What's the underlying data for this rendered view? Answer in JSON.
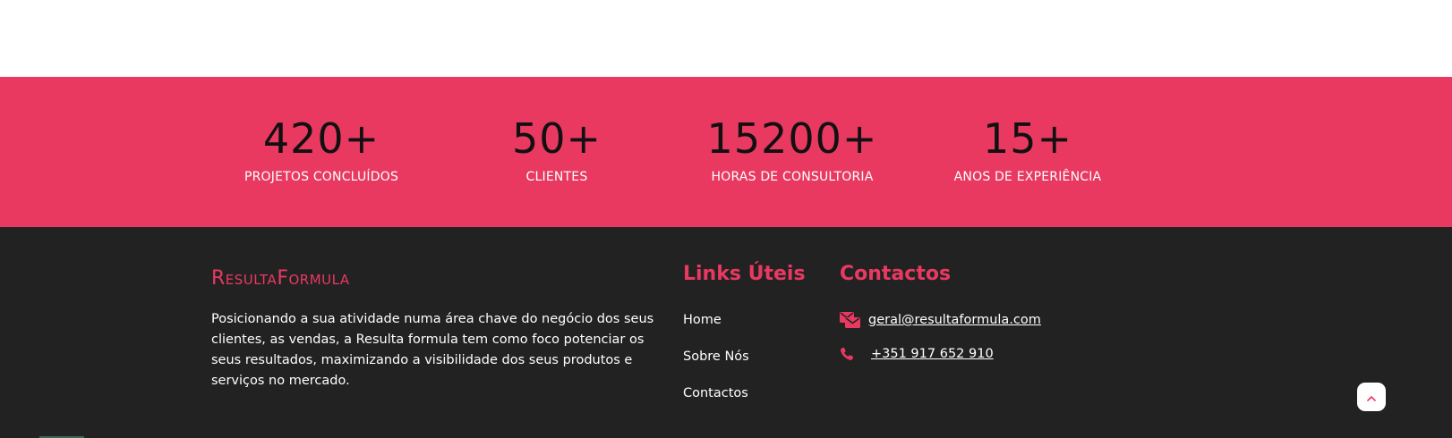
{
  "colors": {
    "accent": "#e93961",
    "footer_bg": "#222223",
    "text_dark": "#111111",
    "text_light": "#ffffff"
  },
  "stats": [
    {
      "value": "420+",
      "label": "PROJETOS CONCLUÍDOS"
    },
    {
      "value": "50+",
      "label": "CLIENTES"
    },
    {
      "value": "15200+",
      "label": "HORAS DE CONSULTORIA"
    },
    {
      "value": "15+",
      "label": "ANOS DE EXPERIÊNCIA"
    }
  ],
  "footer": {
    "brand": "ResultaFormula",
    "description": "Posicionando a sua atividade numa área chave do negócio dos seus clientes, as vendas, a Resulta formula tem como foco potenciar os seus resultados, maximizando a visibilidade dos seus produtos e serviços no mercado.",
    "links_title": "Links Úteis",
    "links": [
      {
        "label": "Home"
      },
      {
        "label": "Sobre Nós"
      },
      {
        "label": "Contactos"
      }
    ],
    "contacts_title": "Contactos",
    "email": {
      "icon": "envelope-icon",
      "text": "geral@resultaformula.com"
    },
    "phone": {
      "icon": "phone-icon",
      "text": "+351 917 652 910"
    },
    "back_to_top_icon": "chevron-up-icon"
  }
}
